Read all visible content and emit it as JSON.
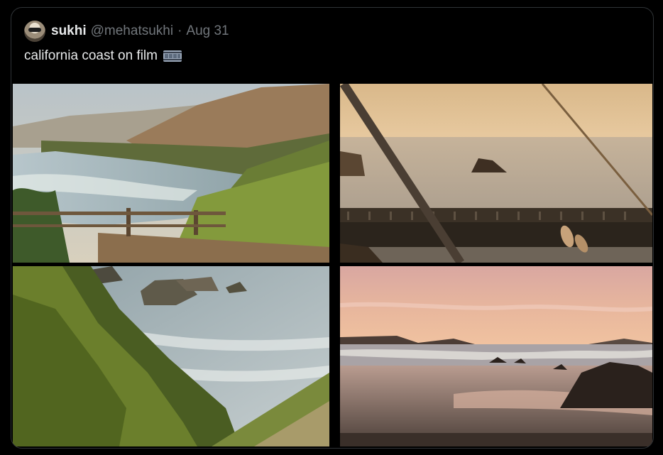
{
  "tweet": {
    "author_name": "sukhi",
    "handle": "@mehatsukhi",
    "separator": "·",
    "date": "Aug 31",
    "text": "california coast on film",
    "text_emoji_icon": "film-frames-icon"
  },
  "media": {
    "images": [
      {
        "name": "coastal-highway-photo",
        "icon": "image"
      },
      {
        "name": "ocean-bridge-railing-photo",
        "icon": "image"
      },
      {
        "name": "cliffside-beach-photo",
        "icon": "image"
      },
      {
        "name": "sunset-beach-photo",
        "icon": "image"
      }
    ]
  }
}
